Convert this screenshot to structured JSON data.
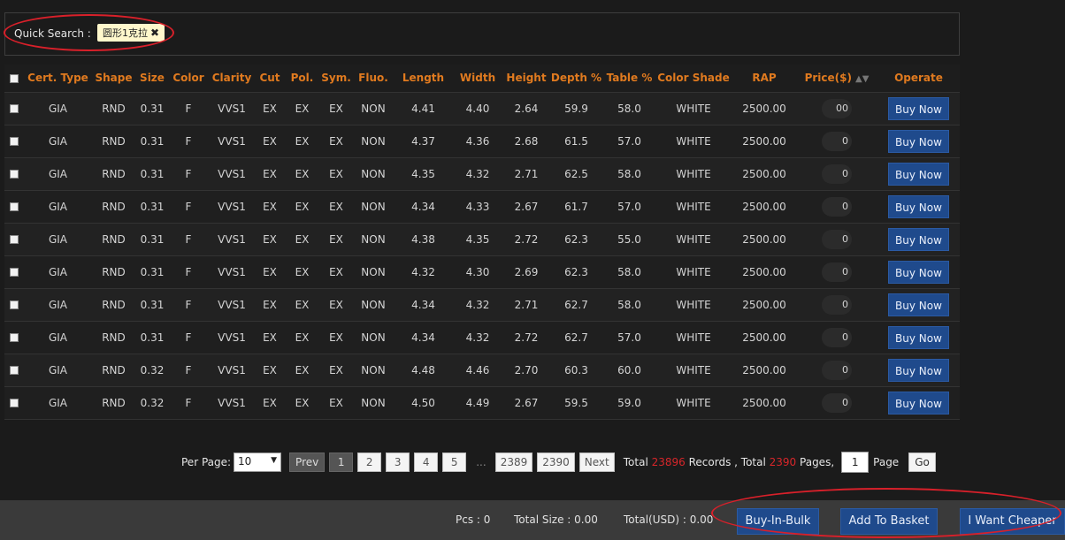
{
  "search": {
    "label": "Quick Search :",
    "tag": "圆形1克拉",
    "remove_icon": "✖"
  },
  "table": {
    "headers": [
      "Cert. Type",
      "Shape",
      "Size",
      "Color",
      "Clarity",
      "Cut",
      "Pol.",
      "Sym.",
      "Fluo.",
      "Length",
      "Width",
      "Height",
      "Depth %",
      "Table %",
      "Color Shade",
      "RAP",
      "Price($)",
      "Operate"
    ],
    "buy_label": "Buy Now",
    "rows": [
      {
        "cert": "GIA",
        "shape": "RND",
        "size": "0.31",
        "color": "F",
        "clarity": "VVS1",
        "cut": "EX",
        "pol": "EX",
        "sym": "EX",
        "fluo": "NON",
        "length": "4.41",
        "width": "4.40",
        "height": "2.64",
        "depth": "59.9",
        "table": "58.0",
        "shade": "WHITE",
        "rap": "2500.00",
        "price": "00"
      },
      {
        "cert": "GIA",
        "shape": "RND",
        "size": "0.31",
        "color": "F",
        "clarity": "VVS1",
        "cut": "EX",
        "pol": "EX",
        "sym": "EX",
        "fluo": "NON",
        "length": "4.37",
        "width": "4.36",
        "height": "2.68",
        "depth": "61.5",
        "table": "57.0",
        "shade": "WHITE",
        "rap": "2500.00",
        "price": "0"
      },
      {
        "cert": "GIA",
        "shape": "RND",
        "size": "0.31",
        "color": "F",
        "clarity": "VVS1",
        "cut": "EX",
        "pol": "EX",
        "sym": "EX",
        "fluo": "NON",
        "length": "4.35",
        "width": "4.32",
        "height": "2.71",
        "depth": "62.5",
        "table": "58.0",
        "shade": "WHITE",
        "rap": "2500.00",
        "price": "0"
      },
      {
        "cert": "GIA",
        "shape": "RND",
        "size": "0.31",
        "color": "F",
        "clarity": "VVS1",
        "cut": "EX",
        "pol": "EX",
        "sym": "EX",
        "fluo": "NON",
        "length": "4.34",
        "width": "4.33",
        "height": "2.67",
        "depth": "61.7",
        "table": "57.0",
        "shade": "WHITE",
        "rap": "2500.00",
        "price": "0"
      },
      {
        "cert": "GIA",
        "shape": "RND",
        "size": "0.31",
        "color": "F",
        "clarity": "VVS1",
        "cut": "EX",
        "pol": "EX",
        "sym": "EX",
        "fluo": "NON",
        "length": "4.38",
        "width": "4.35",
        "height": "2.72",
        "depth": "62.3",
        "table": "55.0",
        "shade": "WHITE",
        "rap": "2500.00",
        "price": "0"
      },
      {
        "cert": "GIA",
        "shape": "RND",
        "size": "0.31",
        "color": "F",
        "clarity": "VVS1",
        "cut": "EX",
        "pol": "EX",
        "sym": "EX",
        "fluo": "NON",
        "length": "4.32",
        "width": "4.30",
        "height": "2.69",
        "depth": "62.3",
        "table": "58.0",
        "shade": "WHITE",
        "rap": "2500.00",
        "price": "0"
      },
      {
        "cert": "GIA",
        "shape": "RND",
        "size": "0.31",
        "color": "F",
        "clarity": "VVS1",
        "cut": "EX",
        "pol": "EX",
        "sym": "EX",
        "fluo": "NON",
        "length": "4.34",
        "width": "4.32",
        "height": "2.71",
        "depth": "62.7",
        "table": "58.0",
        "shade": "WHITE",
        "rap": "2500.00",
        "price": "0"
      },
      {
        "cert": "GIA",
        "shape": "RND",
        "size": "0.31",
        "color": "F",
        "clarity": "VVS1",
        "cut": "EX",
        "pol": "EX",
        "sym": "EX",
        "fluo": "NON",
        "length": "4.34",
        "width": "4.32",
        "height": "2.72",
        "depth": "62.7",
        "table": "57.0",
        "shade": "WHITE",
        "rap": "2500.00",
        "price": "0"
      },
      {
        "cert": "GIA",
        "shape": "RND",
        "size": "0.32",
        "color": "F",
        "clarity": "VVS1",
        "cut": "EX",
        "pol": "EX",
        "sym": "EX",
        "fluo": "NON",
        "length": "4.48",
        "width": "4.46",
        "height": "2.70",
        "depth": "60.3",
        "table": "60.0",
        "shade": "WHITE",
        "rap": "2500.00",
        "price": "0"
      },
      {
        "cert": "GIA",
        "shape": "RND",
        "size": "0.32",
        "color": "F",
        "clarity": "VVS1",
        "cut": "EX",
        "pol": "EX",
        "sym": "EX",
        "fluo": "NON",
        "length": "4.50",
        "width": "4.49",
        "height": "2.67",
        "depth": "59.5",
        "table": "59.0",
        "shade": "WHITE",
        "rap": "2500.00",
        "price": "0"
      }
    ]
  },
  "pager": {
    "per_page_label": "Per Page:",
    "per_page_value": "10",
    "prev": "Prev",
    "pages": [
      "1",
      "2",
      "3",
      "4",
      "5"
    ],
    "dots": "...",
    "last_pages": [
      "2389",
      "2390"
    ],
    "next": "Next",
    "total_prefix": "Total",
    "records_total": "23896",
    "records_suffix": "Records , Total",
    "pages_total": "2390",
    "pages_suffix": "Pages,",
    "goto_value": "1",
    "page_label": "Page",
    "go": "Go"
  },
  "footer": {
    "pcs": "Pcs : 0",
    "total_size": "Total Size : 0.00",
    "total_usd": "Total(USD) : 0.00",
    "buy_in_bulk": "Buy-In-Bulk",
    "add_to_basket": "Add To Basket",
    "want_cheaper": "I Want Cheaper"
  },
  "colors": {
    "background": "#1b1b1b",
    "header_text": "#e07a1f",
    "button_blue": "#1f4a8c",
    "highlight_red": "#d8262a",
    "annotation_ellipse": "#d9202a"
  }
}
